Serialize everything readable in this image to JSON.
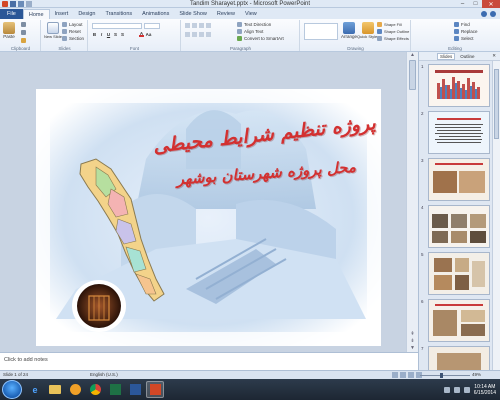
{
  "window": {
    "title": "Tandim Sharayet.pptx - Microsoft PowerPoint",
    "controls": {
      "minimize": "–",
      "maximize": "□",
      "close": "✕"
    }
  },
  "ribbon": {
    "tabs": [
      "File",
      "Home",
      "Insert",
      "Design",
      "Transitions",
      "Animations",
      "Slide Show",
      "Review",
      "View"
    ],
    "active_tab": "Home",
    "groups": {
      "clipboard": {
        "label": "Clipboard",
        "paste": "Paste"
      },
      "slides": {
        "label": "Slides",
        "new_slide": "New Slide",
        "layout": "Layout",
        "reset": "Reset",
        "section": "Section"
      },
      "font": {
        "label": "Font"
      },
      "paragraph": {
        "label": "Paragraph",
        "text_direction": "Text Direction",
        "align_text": "Align Text",
        "convert": "Convert to SmartArt"
      },
      "drawing": {
        "label": "Drawing",
        "arrange": "Arrange",
        "quick_styles": "Quick Styles",
        "shape_fill": "Shape Fill",
        "shape_outline": "Shape Outline",
        "shape_effects": "Shape Effects"
      },
      "editing": {
        "label": "Editing",
        "find": "Find",
        "replace": "Replace",
        "select": "Select"
      }
    }
  },
  "slide": {
    "title": "پروژه تنظیم شرایط محیطی",
    "subtitle": "محل پروژه شهرستان بوشهر"
  },
  "slides_panel": {
    "tab_slides": "Slides",
    "tab_outline": "Outline",
    "close": "✕",
    "numbers": [
      "1",
      "2",
      "3",
      "4",
      "5",
      "6",
      "7"
    ]
  },
  "notes": {
    "placeholder": "Click to add notes"
  },
  "status": {
    "slide_info": "Slide 1 of 24",
    "language": "English (U.S.)",
    "zoom": "49%"
  },
  "taskbar": {
    "items": [
      "ie-icon",
      "explorer-icon",
      "media-player-icon",
      "chrome-icon",
      "excel-icon",
      "word-icon",
      "photoshop-icon",
      "powerpoint-icon"
    ],
    "clock_time": "10:14 AM",
    "clock_date": "6/15/2014"
  },
  "colors": {
    "title_red": "#d33030",
    "file_tab": "#2b5797",
    "selected_thumb": "#e8a83a"
  }
}
